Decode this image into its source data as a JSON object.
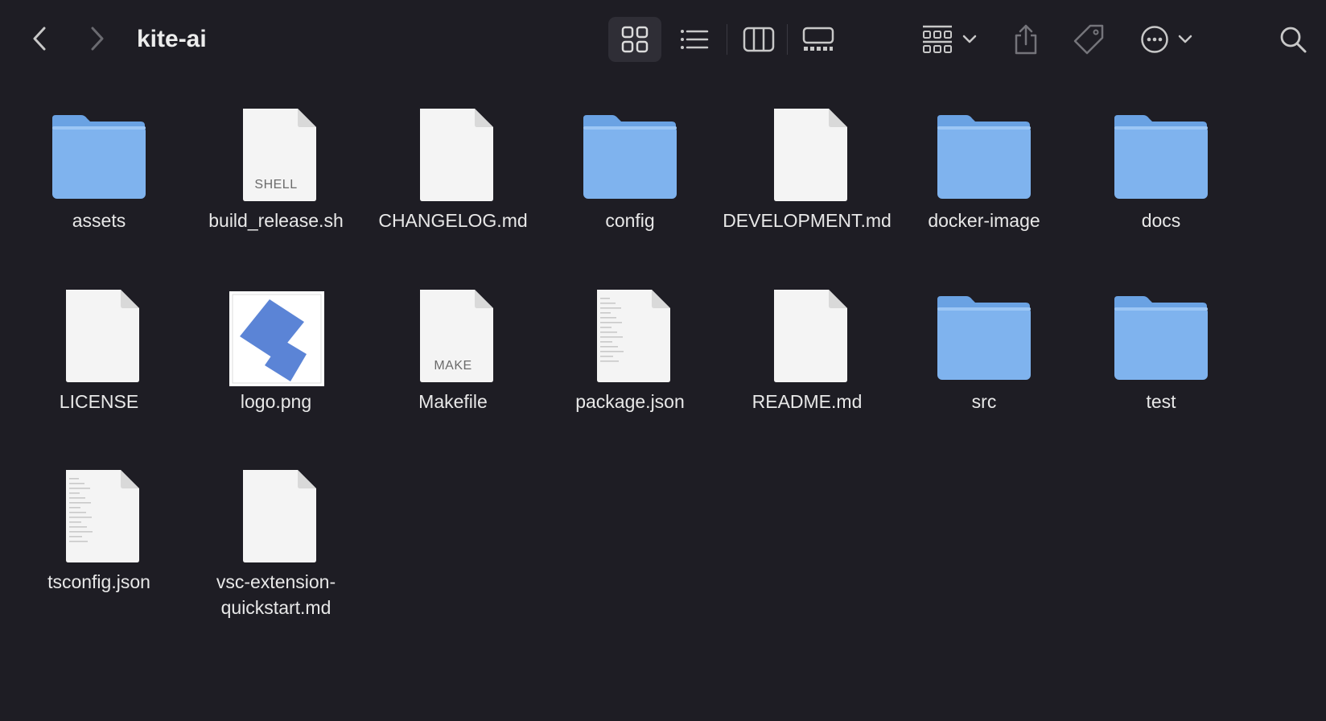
{
  "window": {
    "title": "kite-ai"
  },
  "toolbar": {
    "back": "chevron-left-icon",
    "forward": "chevron-right-icon",
    "view_modes": [
      "icon-view-icon",
      "list-view-icon",
      "column-view-icon",
      "gallery-view-icon"
    ],
    "group": "group-by-icon",
    "share": "share-icon",
    "tags": "tag-icon",
    "more": "more-actions-icon",
    "search": "search-icon"
  },
  "items": [
    {
      "name": "assets",
      "kind": "folder"
    },
    {
      "name": "build_release.sh",
      "kind": "doc",
      "badge": "SHELL"
    },
    {
      "name": "CHANGELOG.md",
      "kind": "doc"
    },
    {
      "name": "config",
      "kind": "folder"
    },
    {
      "name": "DEVELOPMENT.md",
      "kind": "doc"
    },
    {
      "name": "docker-image",
      "kind": "folder"
    },
    {
      "name": "docs",
      "kind": "folder"
    },
    {
      "name": "LICENSE",
      "kind": "doc"
    },
    {
      "name": "logo.png",
      "kind": "image"
    },
    {
      "name": "Makefile",
      "kind": "doc",
      "badge": "MAKE"
    },
    {
      "name": "package.json",
      "kind": "doc"
    },
    {
      "name": "README.md",
      "kind": "doc"
    },
    {
      "name": "src",
      "kind": "folder"
    },
    {
      "name": "test",
      "kind": "folder"
    },
    {
      "name": "tsconfig.json",
      "kind": "doc"
    },
    {
      "name": "vsc-extension-quickstart.md",
      "kind": "doc"
    }
  ],
  "colors": {
    "background": "#1e1d24",
    "folder": "#7fb3ee",
    "folder_tab": "#6aa2e3",
    "doc": "#f4f4f4",
    "logo_blue": "#5b84d6"
  }
}
